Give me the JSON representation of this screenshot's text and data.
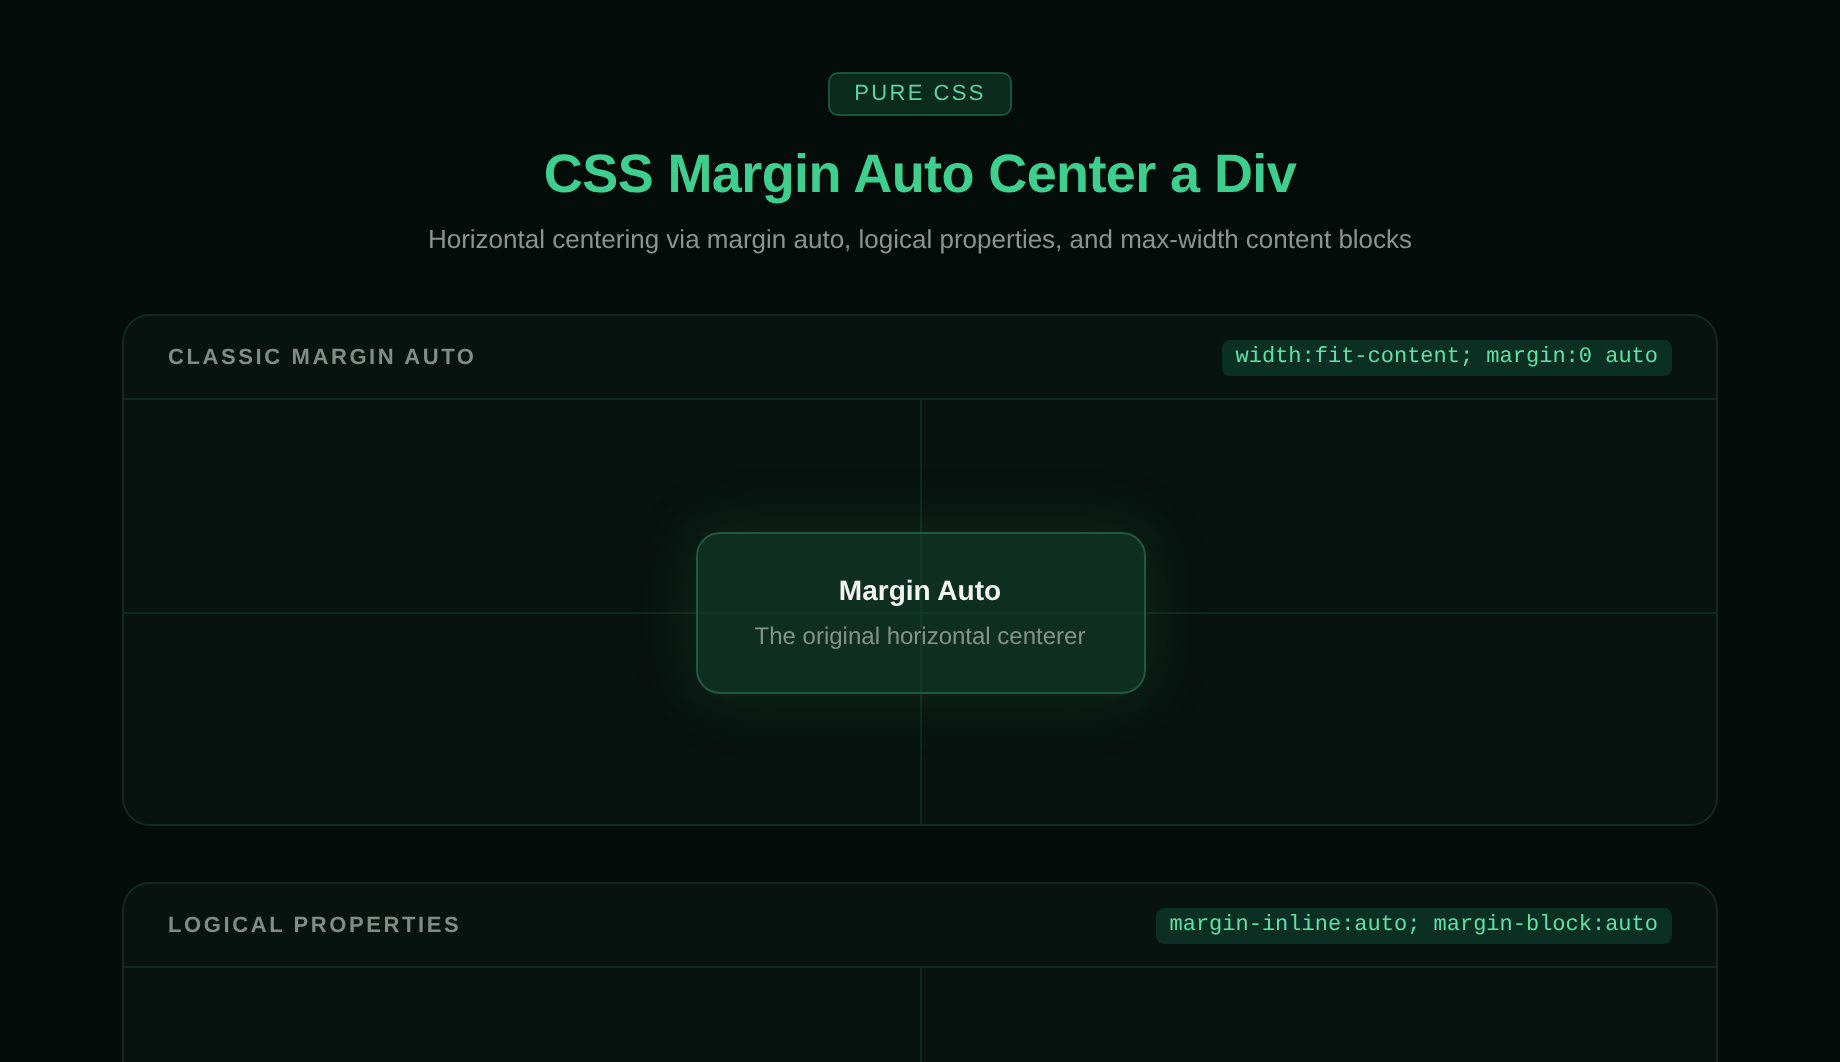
{
  "badge": "PURE CSS",
  "title": "CSS Margin Auto Center a Div",
  "subtitle": "Horizontal centering via margin auto, logical properties, and max-width content blocks",
  "panels": [
    {
      "label": "CLASSIC MARGIN AUTO",
      "code": "width:fit-content; margin:0 auto",
      "card": {
        "title": "Margin Auto",
        "text": "The original horizontal centerer"
      }
    },
    {
      "label": "LOGICAL PROPERTIES",
      "code": "margin-inline:auto; margin-block:auto"
    }
  ]
}
